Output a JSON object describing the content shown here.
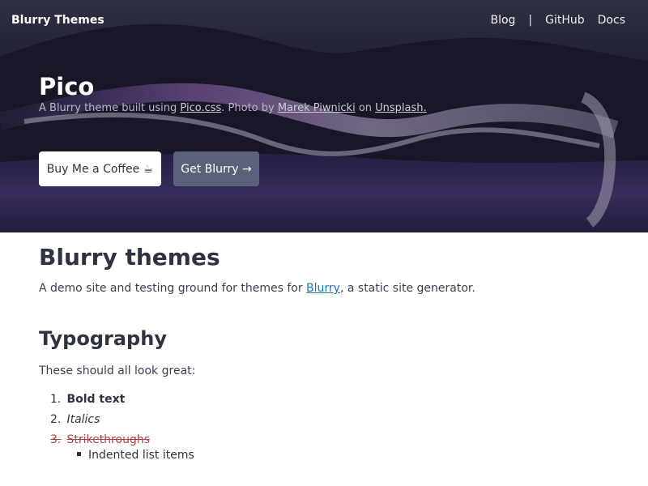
{
  "nav": {
    "brand": "Blurry Themes",
    "links": [
      "Blog",
      "GitHub",
      "Docs"
    ],
    "separator": "|"
  },
  "hero": {
    "title": "Pico",
    "subtitle_prefix": "A Blurry theme built using ",
    "subtitle_link1": "Pico.css",
    "subtitle_middle": ". Photo by ",
    "subtitle_link2": "Marek Piwnicki",
    "subtitle_on": " on ",
    "subtitle_link3": "Unsplash.",
    "buttons": [
      "Buy Me a Coffee ☕",
      "Get Blurry →"
    ]
  },
  "content": {
    "title": "Blurry themes",
    "intro_prefix": "A demo site and testing ground for themes for ",
    "intro_link": "Blurry",
    "intro_suffix": ", a static site generator.",
    "section_title": "Typography",
    "section_intro": "These should all look great:",
    "list": [
      {
        "num": "1.",
        "text": "Bold text"
      },
      {
        "num": "2.",
        "text": "Italics"
      },
      {
        "num": "3.",
        "text": "Strikethroughs"
      }
    ],
    "sublist": [
      "Indented list items"
    ]
  },
  "colors": {
    "link": "#1b75bb",
    "strike": "#a94442",
    "button_secondary": "#5b617b"
  }
}
